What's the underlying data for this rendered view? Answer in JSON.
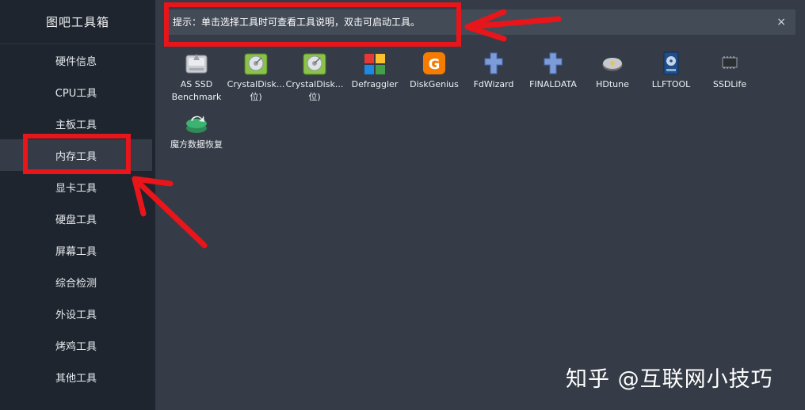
{
  "app": {
    "title": "图吧工具箱"
  },
  "sidebar": {
    "items": [
      {
        "label": "硬件信息"
      },
      {
        "label": "CPU工具"
      },
      {
        "label": "主板工具"
      },
      {
        "label": "内存工具",
        "active": true
      },
      {
        "label": "显卡工具"
      },
      {
        "label": "硬盘工具"
      },
      {
        "label": "屏幕工具"
      },
      {
        "label": "综合检测"
      },
      {
        "label": "外设工具"
      },
      {
        "label": "烤鸡工具"
      },
      {
        "label": "其他工具"
      }
    ]
  },
  "hint": {
    "text": "提示：单击选择工具时可查看工具说明，双击可启动工具。",
    "close": "×"
  },
  "tools": [
    {
      "label": "AS SSD\nBenchmark",
      "icon": "as-ssd-icon"
    },
    {
      "label": "CrystalDisk...\n位)",
      "icon": "crystaldisk-icon"
    },
    {
      "label": "CrystalDisk...\n位)",
      "icon": "crystaldisk-icon"
    },
    {
      "label": "Defraggler",
      "icon": "defraggler-icon"
    },
    {
      "label": "DiskGenius",
      "icon": "diskgenius-icon"
    },
    {
      "label": "FdWizard",
      "icon": "puzzle-icon"
    },
    {
      "label": "FINALDATA",
      "icon": "puzzle-icon"
    },
    {
      "label": "HDtune",
      "icon": "hdtune-icon"
    },
    {
      "label": "LLFTOOL",
      "icon": "llftool-icon"
    },
    {
      "label": "SSDLife",
      "icon": "chip-icon"
    },
    {
      "label": "魔方数据恢复",
      "icon": "recovery-icon"
    }
  ],
  "watermark": {
    "text": "知乎 @互联网小技巧"
  },
  "colors": {
    "sidebar_bg": "#1f252e",
    "main_bg": "#353c47",
    "hint_bg": "#434b57",
    "annotation_red": "#e8151b"
  }
}
